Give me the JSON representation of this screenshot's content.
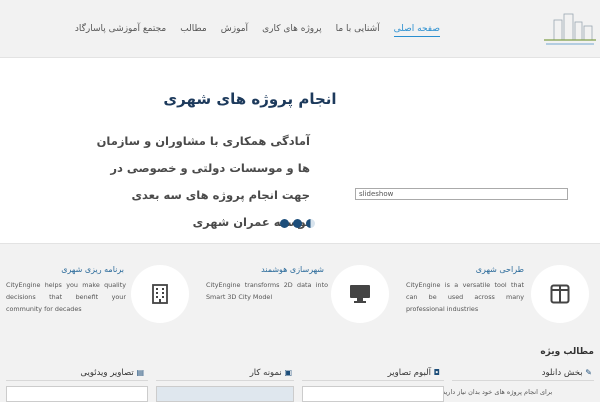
{
  "header": {
    "nav": [
      "صفحه اصلی",
      "آشنایی با ما",
      "پروژه های کاری",
      "آموزش",
      "مطالب",
      "مجتمع آموزشی پاسارگاد"
    ],
    "active_index": 0
  },
  "slider": {
    "title": "انجام پروژه های شهری",
    "text": "آمادگی همکاری با مشاوران و سازمان ها و موسسات دولتی و خصوصی در جهت انجام پروژه های سه بعدی توسعه عمران شهری",
    "slideshow_label": "slideshow"
  },
  "features": [
    {
      "title": "طراحی شهری",
      "text": "CityEngine is a versatile tool that can be used across many professional industries",
      "icon": "layout-icon"
    },
    {
      "title": "شهرسازی هوشمند",
      "text": "CityEngine transforms 2D data into Smart 3D City Model",
      "icon": "monitor-icon"
    },
    {
      "title": "برنامه ریزی شهری",
      "text": "CityEngine helps you make quality decisions that benefit your community for decades",
      "icon": "building-icon"
    }
  ],
  "bottom": {
    "section_title": "مطالب ویژه",
    "columns": [
      {
        "label": "بخش دانلود",
        "icon": "pencil-icon"
      },
      {
        "label": "آلبوم تصاویر",
        "icon": "camera-icon"
      },
      {
        "label": "نمونه کار",
        "icon": "picture-icon"
      },
      {
        "label": "تصاویر ویدئویی",
        "icon": "film-icon"
      }
    ],
    "download_text": "برای انجام پروژه های خود بدان نیاز دارید."
  }
}
